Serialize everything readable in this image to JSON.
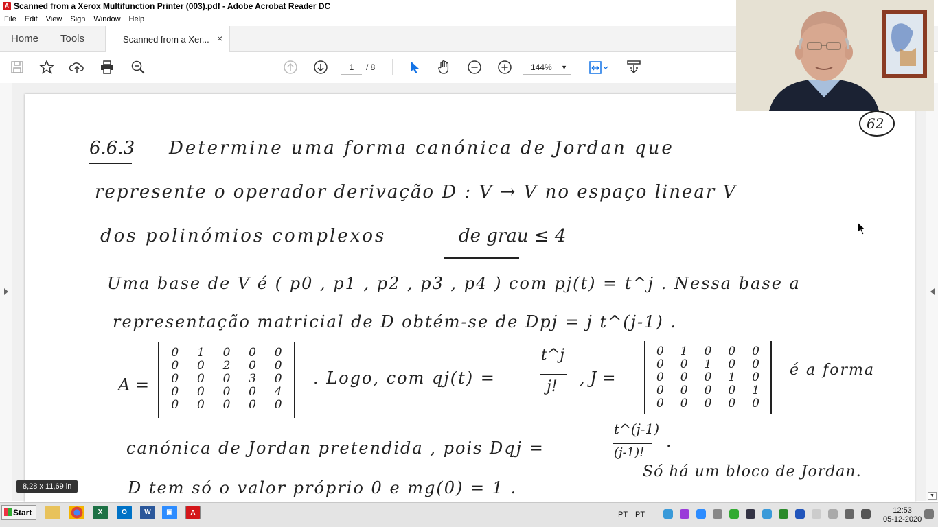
{
  "window": {
    "title": "Scanned from a Xerox Multifunction Printer (003).pdf - Adobe Acrobat Reader DC",
    "app_icon": "acrobat-icon"
  },
  "menu": {
    "items": [
      "File",
      "Edit",
      "View",
      "Sign",
      "Window",
      "Help"
    ]
  },
  "tabs": {
    "home": "Home",
    "tools": "Tools",
    "document": "Scanned from a Xer...",
    "close_glyph": "×"
  },
  "toolbar": {
    "icons": [
      "save-icon",
      "bookmark-star-icon",
      "upload-icon",
      "print-icon",
      "search-zoom-icon",
      "page-up-icon",
      "page-down-icon",
      "select-cursor-icon",
      "hand-pan-icon",
      "zoom-out-icon",
      "zoom-in-icon",
      "fit-page-icon",
      "scroll-mode-icon"
    ],
    "current_page": "1",
    "page_total": "/ 8",
    "zoom": "144%",
    "zoom_caret": "▼"
  },
  "document": {
    "page_badge": "62",
    "line1_num": "6.6.3",
    "line1": "Determine uma forma canónica de Jordan que",
    "line2": "represente o operador derivação D : V → V no espaço linear V",
    "line3a": "dos polinómios complexos",
    "line3b": "de grau ≤ 4",
    "line4": "Uma base de V é ( p0 , p1 , p2 , p3 , p4 ) com pj(t) = t^j . Nessa base a",
    "line5": "representação matricial de D obtém-se de Dpj = j t^(j-1) .",
    "matrix_A_label": "A =",
    "matrix_A": [
      [
        "0",
        "1",
        "0",
        "0",
        "0"
      ],
      [
        "0",
        "0",
        "2",
        "0",
        "0"
      ],
      [
        "0",
        "0",
        "0",
        "3",
        "0"
      ],
      [
        "0",
        "0",
        "0",
        "0",
        "4"
      ],
      [
        "0",
        "0",
        "0",
        "0",
        "0"
      ]
    ],
    "mid_text": ". Logo, com  qj(t) =",
    "frac1_num": "t^j",
    "frac1_den": "j!",
    "comma_J": ",  J =",
    "matrix_J": [
      [
        "0",
        "1",
        "0",
        "0",
        "0"
      ],
      [
        "0",
        "0",
        "1",
        "0",
        "0"
      ],
      [
        "0",
        "0",
        "0",
        "1",
        "0"
      ],
      [
        "0",
        "0",
        "0",
        "0",
        "1"
      ],
      [
        "0",
        "0",
        "0",
        "0",
        "0"
      ]
    ],
    "after_J": "é a forma",
    "line7a": "canónica de Jordan pretendida , pois Dqj =",
    "frac2_num": "t^(j-1)",
    "frac2_den": "(j-1)!",
    "frac2_dot": ".",
    "line8a": "D tem só o valor próprio 0  e  mg(0) = 1 .",
    "line8b": "Só há um bloco de Jordan."
  },
  "status": {
    "page_size": "8,28 x 11,69 in"
  },
  "taskbar": {
    "start": "Start",
    "apps": [
      "file-explorer-icon",
      "chrome-icon",
      "excel-icon",
      "outlook-icon",
      "word-icon",
      "zoom-app-icon",
      "acrobat-taskbar-icon"
    ],
    "lang1": "PT",
    "lang2": "PT",
    "time": "12:53",
    "date": "05-12-2020"
  },
  "colors": {
    "acrobat_red": "#d4171b",
    "excel": "#1e7145",
    "word": "#2b579a",
    "outlook": "#0072c6",
    "zoom": "#2d8cff"
  }
}
